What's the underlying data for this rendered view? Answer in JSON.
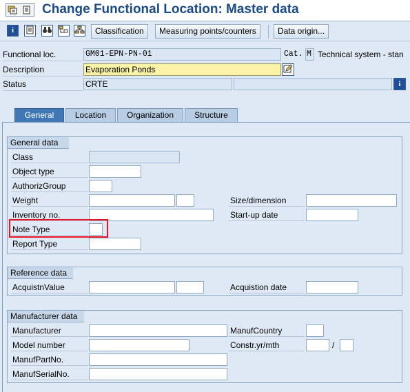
{
  "window": {
    "title": "Change Functional Location: Master data"
  },
  "toolbar": {
    "buttons": {
      "classification": "Classification",
      "measuring_points": "Measuring points/counters",
      "data_origin": "Data origin..."
    }
  },
  "header": {
    "functional_loc": {
      "label": "Functional loc.",
      "value": "GM01-EPN-PN-01"
    },
    "category": {
      "label": "Cat.",
      "value": "M",
      "text": "Technical system - stan"
    },
    "description": {
      "label": "Description",
      "value": "Evaporation Ponds"
    },
    "status": {
      "label": "Status",
      "value": "CRTE",
      "value2": ""
    }
  },
  "tabs": [
    {
      "label": "General",
      "active": true
    },
    {
      "label": "Location",
      "active": false
    },
    {
      "label": "Organization",
      "active": false
    },
    {
      "label": "Structure",
      "active": false
    }
  ],
  "general_data": {
    "title": "General data",
    "class": {
      "label": "Class",
      "value": ""
    },
    "object_type": {
      "label": "Object type",
      "value": ""
    },
    "authoriz_group": {
      "label": "AuthorizGroup",
      "value": ""
    },
    "weight": {
      "label": "Weight",
      "value": "",
      "unit": ""
    },
    "size_dimension": {
      "label": "Size/dimension",
      "value": ""
    },
    "inventory_no": {
      "label": "Inventory no.",
      "value": ""
    },
    "startup_date": {
      "label": "Start-up date",
      "value": ""
    },
    "note_type": {
      "label": "Note Type",
      "value": ""
    },
    "report_type": {
      "label": "Report Type",
      "value": ""
    }
  },
  "reference_data": {
    "title": "Reference data",
    "acquistn_value": {
      "label": "AcquistnValue",
      "value": "",
      "currency": ""
    },
    "acquistion_date": {
      "label": "Acquistion date",
      "value": ""
    }
  },
  "manufacturer_data": {
    "title": "Manufacturer data",
    "manufacturer": {
      "label": "Manufacturer",
      "value": ""
    },
    "manuf_country": {
      "label": "ManufCountry",
      "value": ""
    },
    "model_number": {
      "label": "Model number",
      "value": ""
    },
    "constr_yr_mth": {
      "label": "Constr.yr/mth",
      "year": "",
      "separator": "/",
      "month": ""
    },
    "manuf_part_no": {
      "label": "ManufPartNo.",
      "value": ""
    },
    "manuf_serial_no": {
      "label": "ManufSerialNo.",
      "value": ""
    }
  },
  "icons": {
    "title": "menu-toggle-icon",
    "toolbar": [
      "info-icon",
      "document-icon",
      "binoculars-icon",
      "structure-list-icon",
      "hierarchy-icon"
    ],
    "edit": "edit-long-text-icon",
    "status_info": "status-info-icon"
  },
  "colors": {
    "title": "#1a4b8a",
    "active_tab": "#3f78b4",
    "highlight": "#e8141f",
    "editable_field": "#fbf3a8"
  }
}
